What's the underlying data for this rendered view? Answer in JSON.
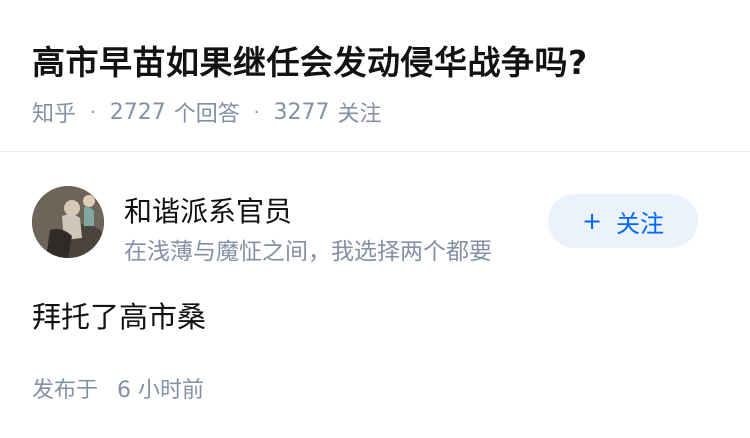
{
  "question": {
    "title": "高市早苗如果继任会发动侵华战争吗?",
    "source": "知乎",
    "separator": "·",
    "answers_count": "2727",
    "answers_label": "个回答",
    "followers_count": "3277",
    "followers_label": "关注"
  },
  "answer": {
    "author": {
      "name": "和谐派系官员",
      "bio": "在浅薄与魔怔之间，我选择两个都要"
    },
    "follow_button": {
      "icon": "plus-icon",
      "label": "关注",
      "color": "#0066ff",
      "background": "#ebf2fb"
    },
    "content": "拜托了高市桑",
    "published_label": "发布于",
    "published_time": "6 小时前"
  }
}
